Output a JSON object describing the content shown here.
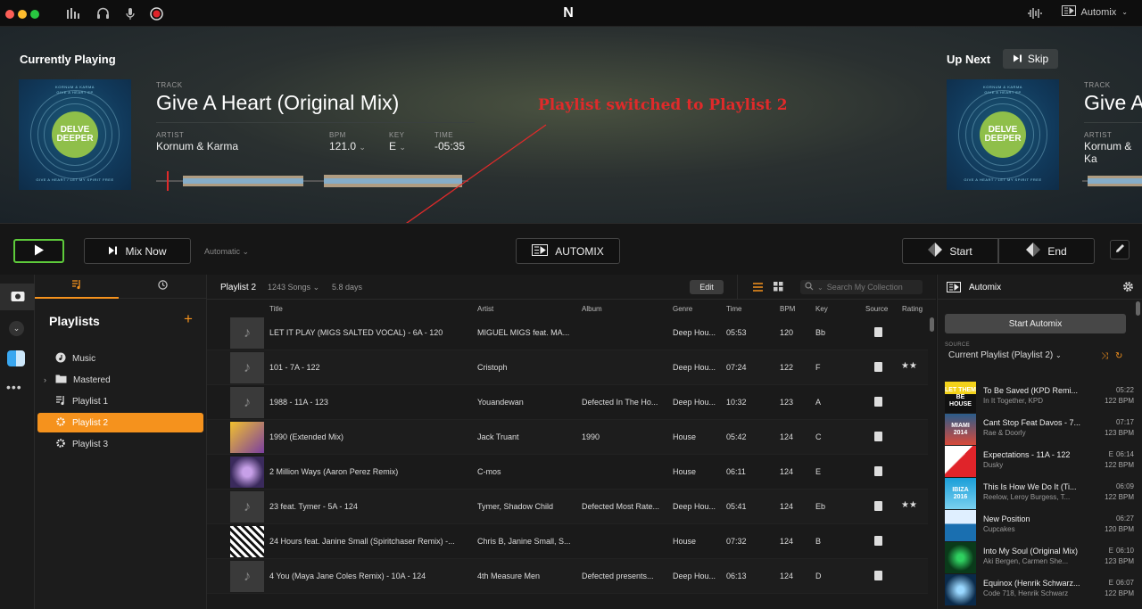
{
  "colors": {
    "accent": "#f5921d",
    "annotation": "#e02a2a",
    "play_border": "#5ecb3b"
  },
  "current": {
    "heading": "Currently Playing",
    "track_label": "TRACK",
    "track": "Give A Heart (Original Mix)",
    "artist_label": "ARTIST",
    "artist": "Kornum & Karma",
    "bpm_label": "BPM",
    "bpm": "121.0",
    "key_label": "KEY",
    "key": "E",
    "time_label": "TIME",
    "time": "-05:35",
    "cover_text_top": "KORNUM & KARMA",
    "cover_text_sub": "GIVE A HEART EP",
    "cover_logo_1": "DELVE",
    "cover_logo_2": "DEEPER",
    "cover_text_bottom": "GIVE A HEART / LET MY SPIRIT FREE"
  },
  "upnext": {
    "heading": "Up Next",
    "skip": "Skip",
    "track_label": "TRACK",
    "track": "Give A",
    "artist_label": "ARTIST",
    "artist": "Kornum & Ka"
  },
  "annotation": "Playlist switched to Playlist 2",
  "transport": {
    "mix_now": "Mix Now",
    "mode": "Automatic",
    "automix": "AUTOMIX",
    "start": "Start",
    "end": "End"
  },
  "topbar": {
    "automix": "Automix",
    "logo": "N"
  },
  "sidebar": {
    "heading": "Playlists",
    "add": "+",
    "items": [
      {
        "label": "Music",
        "icon": "music-icon"
      },
      {
        "label": "Mastered",
        "icon": "folder-icon"
      },
      {
        "label": "Playlist 1",
        "icon": "playlist-icon"
      },
      {
        "label": "Playlist 2",
        "icon": "smart-playlist-icon",
        "selected": true
      },
      {
        "label": "Playlist 3",
        "icon": "smart-playlist-icon"
      }
    ]
  },
  "main": {
    "playlist": "Playlist 2",
    "songs": "1243 Songs",
    "duration": "5.8 days",
    "edit": "Edit",
    "search_placeholder": "Search My Collection",
    "columns": {
      "title": "Title",
      "artist": "Artist",
      "album": "Album",
      "genre": "Genre",
      "time": "Time",
      "bpm": "BPM",
      "key": "Key",
      "source": "Source",
      "rating": "Rating"
    },
    "rows": [
      {
        "title": "LET IT PLAY (MIGS SALTED VOCAL) - 6A - 120",
        "artist": "MIGUEL MIGS feat. MA...",
        "album": "",
        "genre": "Deep Hou...",
        "time": "05:53",
        "bpm": "120",
        "key": "Bb",
        "rating": ""
      },
      {
        "title": "101 - 7A - 122",
        "artist": "Cristoph",
        "album": "",
        "genre": "Deep Hou...",
        "time": "07:24",
        "bpm": "122",
        "key": "F",
        "rating": "★★"
      },
      {
        "title": "1988 - 11A - 123",
        "artist": "Youandewan",
        "album": "Defected In The Ho...",
        "genre": "Deep Hou...",
        "time": "10:32",
        "bpm": "123",
        "key": "A",
        "rating": ""
      },
      {
        "title": "1990 (Extended Mix)",
        "artist": "Jack Truant",
        "album": "1990",
        "genre": "House",
        "time": "05:42",
        "bpm": "124",
        "key": "C",
        "rating": ""
      },
      {
        "title": "2 Million Ways (Aaron Perez Remix)",
        "artist": "C-mos",
        "album": "",
        "genre": "House",
        "time": "06:11",
        "bpm": "124",
        "key": "E",
        "rating": ""
      },
      {
        "title": "23 feat. Tymer - 5A - 124",
        "artist": "Tymer, Shadow Child",
        "album": "Defected Most Rate...",
        "genre": "Deep Hou...",
        "time": "05:41",
        "bpm": "124",
        "key": "Eb",
        "rating": "★★"
      },
      {
        "title": "24 Hours feat. Janine Small (Spiritchaser Remix) -...",
        "artist": "Chris B, Janine Small, S...",
        "album": "",
        "genre": "House",
        "time": "07:32",
        "bpm": "124",
        "key": "B",
        "rating": ""
      },
      {
        "title": "4 You (Maya Jane Coles Remix) - 10A - 124",
        "artist": "4th Measure Men",
        "album": "Defected presents...",
        "genre": "Deep Hou...",
        "time": "06:13",
        "bpm": "124",
        "key": "D",
        "rating": ""
      }
    ]
  },
  "automix_panel": {
    "title": "Automix",
    "start": "Start Automix",
    "source_label": "SOURCE",
    "source": "Current Playlist (Playlist 2)",
    "queue": [
      {
        "title": "To Be Saved (KPD  Remi...",
        "artist": "In It Together, KPD",
        "time": "05:22",
        "bpm": "122 BPM",
        "prefix": ""
      },
      {
        "title": "Cant Stop Feat Davos - 7...",
        "artist": "Rae & Doorly",
        "time": "07:17",
        "bpm": "123 BPM",
        "prefix": ""
      },
      {
        "title": "Expectations - 11A - 122",
        "artist": "Dusky",
        "time": "06:14",
        "bpm": "122 BPM",
        "prefix": "E"
      },
      {
        "title": "This Is How We Do It (Ti...",
        "artist": "Reelow, Leroy Burgess, T...",
        "time": "06:09",
        "bpm": "122 BPM",
        "prefix": ""
      },
      {
        "title": "New Position",
        "artist": "Cupcakes",
        "time": "06:27",
        "bpm": "120 BPM",
        "prefix": ""
      },
      {
        "title": "Into My Soul (Original Mix)",
        "artist": "Aki Bergen, Carmen She...",
        "time": "06:10",
        "bpm": "123 BPM",
        "prefix": "E"
      },
      {
        "title": "Equinox (Henrik Schwarz...",
        "artist": "Code 718, Henrik Schwarz",
        "time": "06:07",
        "bpm": "122 BPM",
        "prefix": "E"
      }
    ],
    "thumb_texts": [
      "LET THEM BE HOUSE",
      "MIAMI 2014",
      "",
      "IBIZA 2016",
      "",
      "",
      ""
    ]
  }
}
